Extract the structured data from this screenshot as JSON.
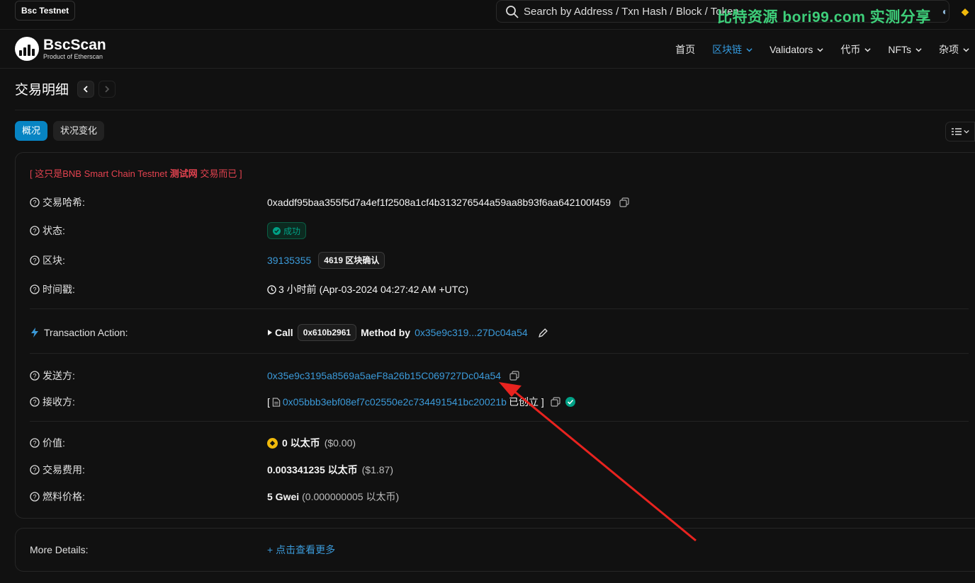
{
  "topbar": {
    "network": "Bsc Testnet",
    "search_placeholder": "Search by Address / Txn Hash / Block / Token",
    "watermark": "比特资源 bori99.com 实测分享"
  },
  "header": {
    "logo_title": "BscScan",
    "logo_sub": "Product of Etherscan",
    "nav": [
      {
        "label": "首页",
        "dropdown": false
      },
      {
        "label": "区块链",
        "dropdown": true,
        "active": true
      },
      {
        "label": "Validators",
        "dropdown": true
      },
      {
        "label": "代币",
        "dropdown": true
      },
      {
        "label": "NFTs",
        "dropdown": true
      },
      {
        "label": "杂项",
        "dropdown": true
      }
    ]
  },
  "page": {
    "title": "交易明细",
    "tabs": [
      "概况",
      "状况变化"
    ]
  },
  "details": {
    "notice_prefix": "[ 这只是BNB Smart Chain Testnet ",
    "notice_bold": "测试网",
    "notice_suffix": " 交易而已 ]",
    "hash_label": "交易哈希:",
    "hash_value": "0xaddf95baa355f5d7a4ef1f2508a1cf4b313276544a59aa8b93f6aa642100f459",
    "status_label": "状态:",
    "status_value": "成功",
    "block_label": "区块:",
    "block_value": "39135355",
    "block_confirmations": "4619 区块确认",
    "timestamp_label": "时间戳:",
    "timestamp_value": "3 小时前 (Apr-03-2024 04:27:42 AM +UTC)",
    "action_label": "Transaction Action:",
    "action_call": "Call",
    "action_method": "0x610b2961",
    "action_method_by": "Method by",
    "action_address": "0x35e9c319...27Dc04a54",
    "from_label": "发送方:",
    "from_value": "0x35e9c3195a8569a5aeF8a26b15C069727Dc04a54",
    "to_label": "接收方:",
    "to_open": "[",
    "to_value": "0x05bbb3ebf08ef7c02550e2c734491541bc20021b",
    "to_suffix": "已创立 ]",
    "value_label": "价值:",
    "value_amount": "0 以太币",
    "value_usd": "($0.00)",
    "fee_label": "交易费用:",
    "fee_amount": "0.003341235 以太币",
    "fee_usd": "($1.87)",
    "gas_label": "燃料价格:",
    "gas_amount": "5 Gwei",
    "gas_detail": "(0.000000005 以太币)"
  },
  "more": {
    "label": "More Details:",
    "link": "+ 点击查看更多"
  },
  "colors": {
    "accent": "#0784c3",
    "link": "#3b9ad9",
    "success": "#00a186",
    "warning": "#e3424f",
    "annotation_arrow": "#e8231f"
  }
}
